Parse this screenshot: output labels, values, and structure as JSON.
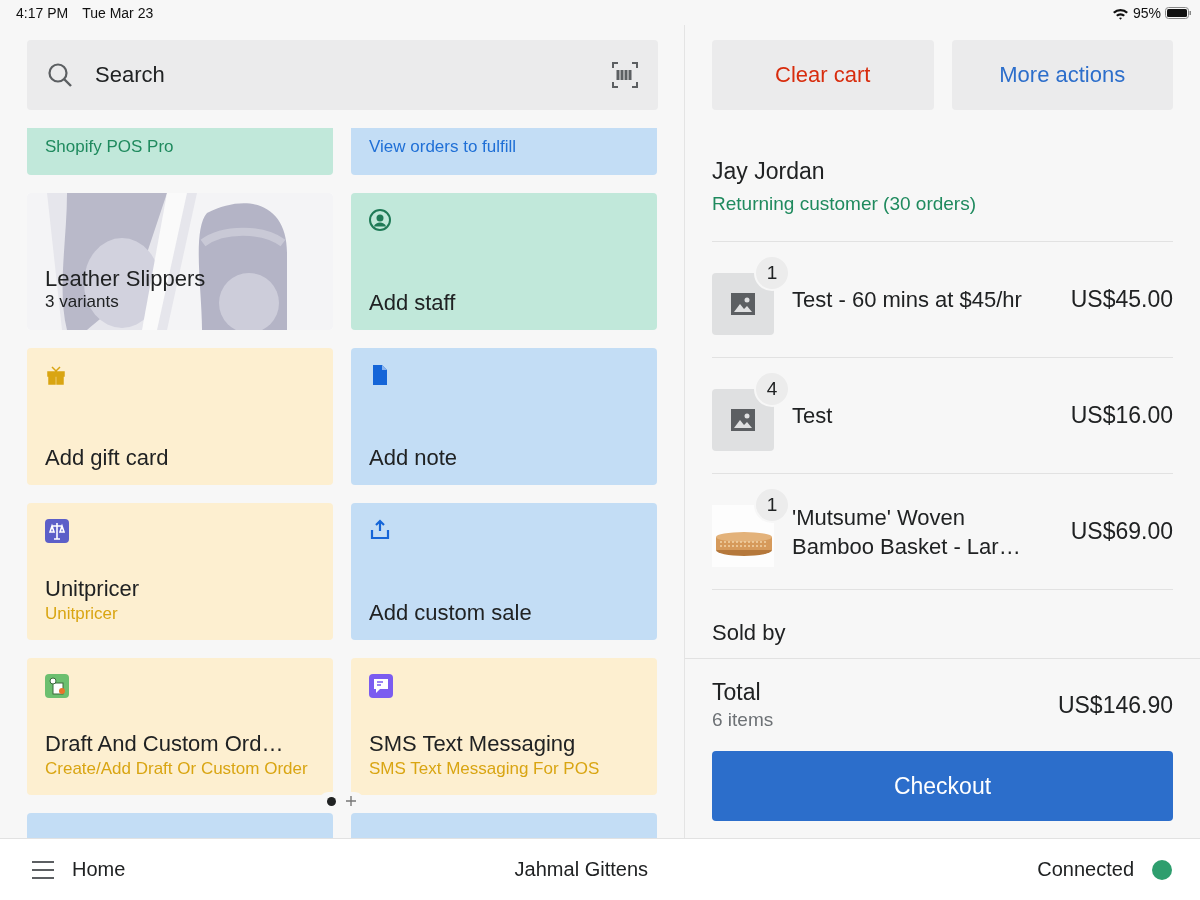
{
  "status_bar": {
    "time": "4:17 PM",
    "date": "Tue Mar 23",
    "battery": "95%"
  },
  "search": {
    "placeholder": "Search"
  },
  "tiles": [
    {
      "kind": "clipped",
      "color": "#c1e8da",
      "subtitle": "Shopify POS Pro"
    },
    {
      "kind": "clipped",
      "color": "#c3ddf5",
      "subtitle": "View orders to fulfill"
    },
    {
      "kind": "product",
      "title": "Leather Slippers",
      "subtitle": "3 variants"
    },
    {
      "kind": "action",
      "color": "#c1e8da",
      "title": "Add staff"
    },
    {
      "kind": "action",
      "color": "#fdefd0",
      "title": "Add gift card"
    },
    {
      "kind": "action",
      "color": "#c3ddf5",
      "title": "Add note"
    },
    {
      "kind": "action",
      "color": "#fdefd0",
      "title": "Unitpricer",
      "subtitle": "Unitpricer"
    },
    {
      "kind": "action",
      "color": "#c3ddf5",
      "title": "Add custom sale"
    },
    {
      "kind": "action",
      "color": "#fdefd0",
      "title": "Draft And Custom Ord…",
      "subtitle": "Create/Add Draft Or Custom Order"
    },
    {
      "kind": "action",
      "color": "#fdefd0",
      "title": "SMS Text Messaging",
      "subtitle": "SMS Text Messaging For POS"
    },
    {
      "kind": "peek",
      "color": "#c3ddf5"
    },
    {
      "kind": "peek",
      "color": "#c3ddf5"
    }
  ],
  "page_dots": [
    {
      "kind": "dot",
      "selected": true
    },
    {
      "kind": "plus",
      "selected": false
    }
  ],
  "cart": {
    "actions": [
      {
        "label": "Clear cart",
        "kind": "danger"
      },
      {
        "label": "More actions",
        "kind": "link"
      }
    ],
    "customer": {
      "name": "Jay Jordan",
      "note": "Returning customer (30 orders)"
    },
    "items": [
      {
        "quantity": "1",
        "name": "Test - 60 mins at $45/hr",
        "price": "US$45.00",
        "kind": "placeholder"
      },
      {
        "quantity": "4",
        "name": "Test",
        "price": "US$16.00",
        "kind": "placeholder"
      },
      {
        "quantity": "1",
        "name": "'Mutsume' Woven Bamboo Basket - Lar…",
        "price": "US$69.00"
      }
    ],
    "sold_by_label": "Sold by",
    "total": {
      "label": "Total",
      "count": "6 items",
      "amount": "US$146.90"
    },
    "checkout": "Checkout"
  },
  "nav": {
    "home": "Home",
    "staff": "Jahmal Gittens",
    "connection": "Connected",
    "online": true
  }
}
